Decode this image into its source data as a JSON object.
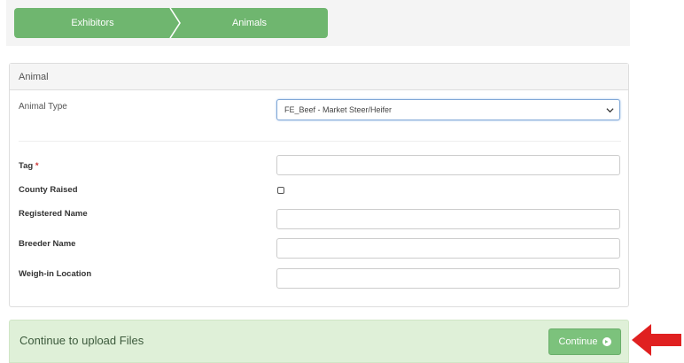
{
  "wizard": {
    "steps": [
      {
        "label": "Exhibitors"
      },
      {
        "label": "Animals"
      }
    ]
  },
  "panel": {
    "title": "Animal",
    "animal_type": {
      "label": "Animal Type",
      "selected": "FE_Beef - Market Steer/Heifer"
    },
    "fields": {
      "tag": {
        "label": "Tag",
        "required_mark": "*",
        "value": ""
      },
      "county_raised": {
        "label": "County Raised",
        "checked": false
      },
      "registered_name": {
        "label": "Registered Name",
        "value": ""
      },
      "breeder_name": {
        "label": "Breeder Name",
        "value": ""
      },
      "weighin_location": {
        "label": "Weigh-in Location",
        "value": ""
      }
    }
  },
  "continue_bar": {
    "message": "Continue to upload Files",
    "button_label": "Continue"
  },
  "icons": {
    "select_chevron": "chevron-down-icon",
    "continue_arrow": "arrow-circle-right-icon",
    "pointer": "red-arrow-left-icon"
  },
  "colors": {
    "wizard_green": "#6fb66f",
    "continue_bg": "#dff0d8",
    "button_green": "#7cc27c",
    "pointer_red": "#e02020"
  }
}
